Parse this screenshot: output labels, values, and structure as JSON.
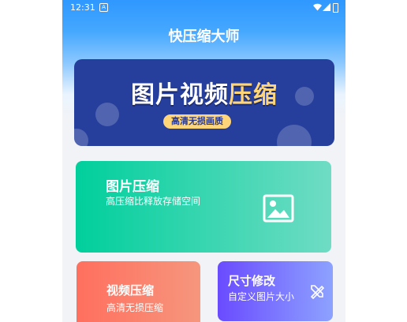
{
  "status_bar": {
    "time": "12:31",
    "notification_icon": "a-icon"
  },
  "app": {
    "title": "快压缩大师"
  },
  "banner": {
    "main_before": "图片视频",
    "main_highlight": "压缩",
    "subtitle": "高清无损画质"
  },
  "cards": {
    "image_compress": {
      "title": "图片压缩",
      "subtitle": "高压缩比释放存储空间",
      "icon": "image-icon"
    },
    "video_compress": {
      "title": "视频压缩",
      "subtitle": "高清无损压缩"
    },
    "size_modify": {
      "title": "尺寸修改",
      "subtitle": "自定义图片大小",
      "icon": "ruler-pencil-icon"
    }
  },
  "colors": {
    "header_blue": "#2f98ff",
    "banner_navy": "#263e9c",
    "accent_yellow": "#ffd57a",
    "image_card_green": "#00cf9c",
    "video_card_red": "#ff6f5e",
    "size_card_purple": "#6a4bff"
  }
}
